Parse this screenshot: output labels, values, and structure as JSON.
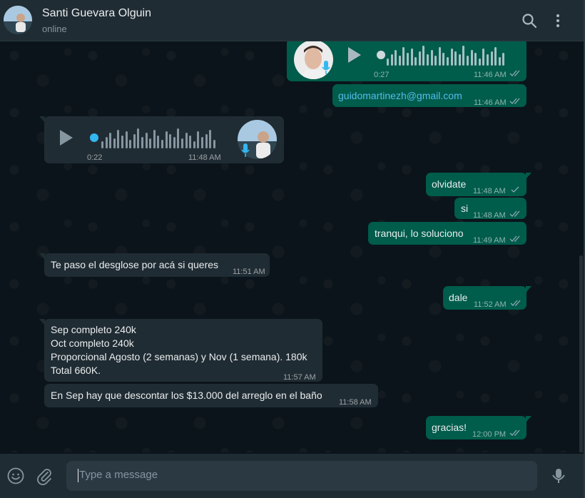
{
  "header": {
    "contact_name": "Santi Guevara Olguin",
    "status": "online"
  },
  "messages": [
    {
      "kind": "voice",
      "direction": "out",
      "duration": "0:27",
      "time": "11:46 AM",
      "ticks": "read"
    },
    {
      "kind": "text",
      "direction": "out",
      "text": "guidomartinezh@gmail.com",
      "time": "11:46 AM",
      "ticks": "read",
      "is_link": true
    },
    {
      "kind": "voice",
      "direction": "in",
      "duration": "0:22",
      "time": "11:48 AM"
    },
    {
      "kind": "text",
      "direction": "out",
      "text": "olvidate",
      "time": "11:48 AM",
      "ticks": "sent"
    },
    {
      "kind": "text",
      "direction": "out",
      "text": "si",
      "time": "11:48 AM",
      "ticks": "read"
    },
    {
      "kind": "text",
      "direction": "out",
      "text": "tranqui, lo soluciono",
      "time": "11:49 AM",
      "ticks": "read"
    },
    {
      "kind": "text",
      "direction": "in",
      "text": "Te paso el desglose por acá si queres",
      "time": "11:51 AM"
    },
    {
      "kind": "text",
      "direction": "out",
      "text": "dale",
      "time": "11:52 AM",
      "ticks": "read"
    },
    {
      "kind": "text",
      "direction": "in",
      "lines": [
        "Sep completo 240k",
        "Oct completo 240k",
        "Proporcional Agosto (2 semanas) y Nov (1 semana). 180k",
        "Total 660K."
      ],
      "time": "11:57 AM"
    },
    {
      "kind": "text",
      "direction": "in",
      "text": "En Sep hay que descontar los $13.000 del arreglo en el baño",
      "time": "11:58 AM"
    },
    {
      "kind": "text",
      "direction": "out",
      "text": "gracias!",
      "time": "12:00 PM",
      "ticks": "read"
    }
  ],
  "composer": {
    "placeholder": "Type a message"
  },
  "icons": [
    "search-icon",
    "menu-dots-icon",
    "emoji-icon",
    "attach-icon",
    "microphone-icon",
    "play-icon",
    "read-ticks-icon",
    "sent-tick-icon"
  ],
  "colors": {
    "outgoing_bubble": "#005c4b",
    "incoming_bubble": "#202c33",
    "link": "#53bdeb",
    "read_ticks": "#8696a0"
  }
}
